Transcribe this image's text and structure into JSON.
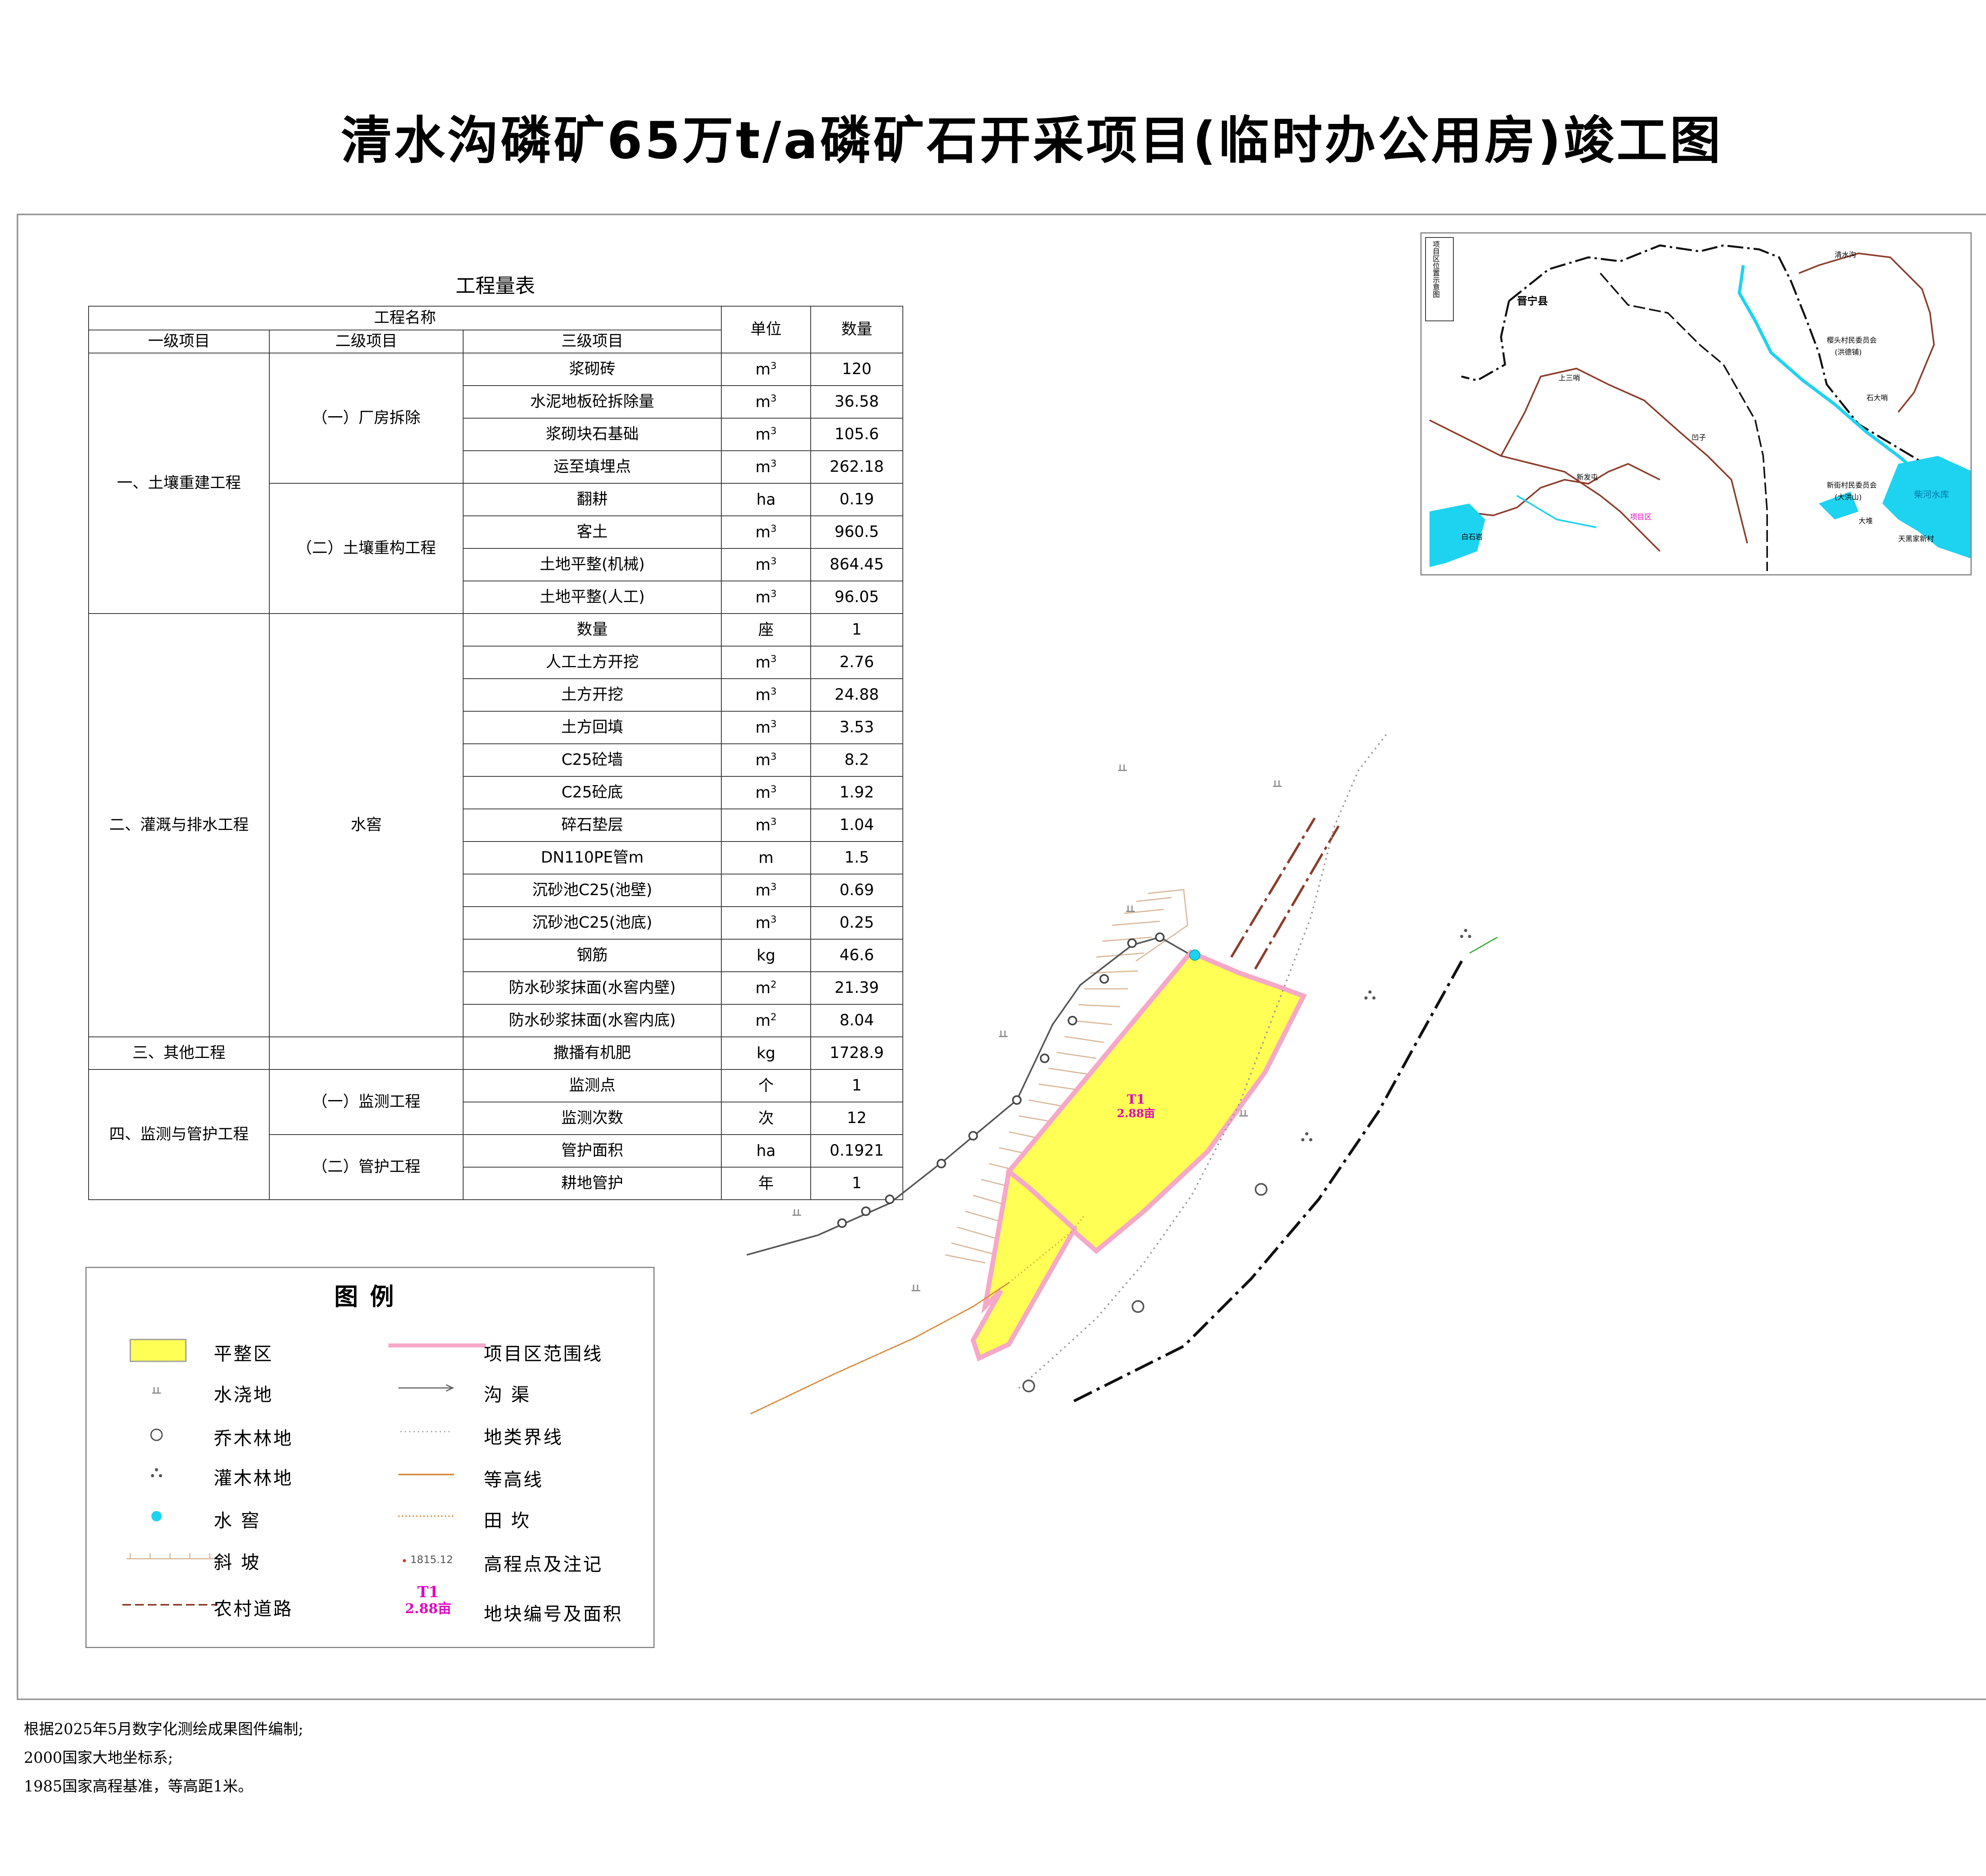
{
  "title": "清水沟磷矿65万t/a磷矿石开采项目(临时办公用房)竣工图",
  "table": {
    "caption": "工程量表",
    "header": {
      "project_name": "工程名称",
      "level1": "一级项目",
      "level2": "二级项目",
      "level3": "三级项目",
      "unit": "单位",
      "quantity": "数量"
    },
    "groups": [
      {
        "level1": "一、土壤重建工程",
        "subgroups": [
          {
            "level2": "（一）厂房拆除",
            "rows": [
              {
                "item": "浆砌砖",
                "unit": "m",
                "sup": "3",
                "qty": "120"
              },
              {
                "item": "水泥地板砼拆除量",
                "unit": "m",
                "sup": "3",
                "qty": "36.58"
              },
              {
                "item": "浆砌块石基础",
                "unit": "m",
                "sup": "3",
                "qty": "105.6"
              },
              {
                "item": "运至填埋点",
                "unit": "m",
                "sup": "3",
                "qty": "262.18"
              }
            ]
          },
          {
            "level2": "（二）土壤重构工程",
            "rows": [
              {
                "item": "翻耕",
                "unit": "ha",
                "sup": "",
                "qty": "0.19"
              },
              {
                "item": "客土",
                "unit": "m",
                "sup": "3",
                "qty": "960.5"
              },
              {
                "item": "土地平整(机械)",
                "unit": "m",
                "sup": "3",
                "qty": "864.45"
              },
              {
                "item": "土地平整(人工)",
                "unit": "m",
                "sup": "3",
                "qty": "96.05"
              }
            ]
          }
        ]
      },
      {
        "level1": "二、灌溉与排水工程",
        "subgroups": [
          {
            "level2": "水窖",
            "rows": [
              {
                "item": "数量",
                "unit": "座",
                "sup": "",
                "qty": "1"
              },
              {
                "item": "人工土方开挖",
                "unit": "m",
                "sup": "3",
                "qty": "2.76"
              },
              {
                "item": "土方开挖",
                "unit": "m",
                "sup": "3",
                "qty": "24.88"
              },
              {
                "item": "土方回填",
                "unit": "m",
                "sup": "3",
                "qty": "3.53"
              },
              {
                "item": "C25砼墙",
                "unit": "m",
                "sup": "3",
                "qty": "8.2"
              },
              {
                "item": "C25砼底",
                "unit": "m",
                "sup": "3",
                "qty": "1.92"
              },
              {
                "item": "碎石垫层",
                "unit": "m",
                "sup": "3",
                "qty": "1.04"
              },
              {
                "item": "DN110PE管m",
                "unit": "m",
                "sup": "",
                "qty": "1.5"
              },
              {
                "item": "沉砂池C25(池壁)",
                "unit": "m",
                "sup": "3",
                "qty": "0.69"
              },
              {
                "item": "沉砂池C25(池底)",
                "unit": "m",
                "sup": "3",
                "qty": "0.25"
              },
              {
                "item": "钢筋",
                "unit": "kg",
                "sup": "",
                "qty": "46.6"
              },
              {
                "item": "防水砂浆抹面(水窖内壁)",
                "unit": "m",
                "sup": "2",
                "qty": "21.39"
              },
              {
                "item": "防水砂浆抹面(水窖内底)",
                "unit": "m",
                "sup": "2",
                "qty": "8.04"
              }
            ]
          }
        ]
      },
      {
        "level1": "三、其他工程",
        "subgroups": [
          {
            "level2": "",
            "rows": [
              {
                "item": "撒播有机肥",
                "unit": "kg",
                "sup": "",
                "qty": "1728.9"
              }
            ]
          }
        ]
      },
      {
        "level1": "四、监测与管护工程",
        "subgroups": [
          {
            "level2": "（一）监测工程",
            "rows": [
              {
                "item": "监测点",
                "unit": "个",
                "sup": "",
                "qty": "1"
              },
              {
                "item": "监测次数",
                "unit": "次",
                "sup": "",
                "qty": "12"
              }
            ]
          },
          {
            "level2": "（二）管护工程",
            "rows": [
              {
                "item": "管护面积",
                "unit": "ha",
                "sup": "",
                "qty": "0.1921"
              },
              {
                "item": "耕地管护",
                "unit": "年",
                "sup": "",
                "qty": "1"
              }
            ]
          }
        ]
      }
    ]
  },
  "legend": {
    "title": "图例",
    "items": {
      "leveling_area": "平整区",
      "irrigated_land": "水浇地",
      "arbor_forest": "乔木林地",
      "shrub_forest": "灌木林地",
      "water_cellar": "水  窖",
      "slope": "斜  坡",
      "rural_road": "农村道路",
      "project_boundary": "项目区范围线",
      "ditch": "沟  渠",
      "landclass_boundary": "地类界线",
      "contour": "等高线",
      "field_ridge": "田  坎",
      "elevation_point": "高程点及注记",
      "elevation_sample": "1815.12",
      "parcel_note": "地块编号及面积",
      "parcel_id_sample": "T1",
      "parcel_area_sample": "2.88亩"
    }
  },
  "map": {
    "parcel_id": "T1",
    "parcel_area": "2.88亩"
  },
  "inset": {
    "title": "项目区位置示意图",
    "labels": {
      "county": "晋宁县",
      "place1": "清水沟",
      "place2": "樱头村民委员会",
      "place3": "(洪德铺)",
      "place4": "上三哨",
      "place5": "白石岩",
      "place6": "项目区",
      "place7": "新街村民委员会",
      "place8": "(大洪山)",
      "place9": "柴河水库",
      "place10": "天黑家新村",
      "place11": "石大哨",
      "place12": "凹子",
      "place13": "新发屯",
      "place14": "大堆"
    }
  },
  "notes": [
    "根据2025年5月数字化测绘成果图件编制;",
    "2000国家大地坐标系;",
    "1985国家高程基准，等高距1米。"
  ],
  "colors": {
    "leveling_fill": "#ffff55",
    "boundary": "#f6a8c8",
    "parcel_label": "#e000c0",
    "water": "#1ed3f0",
    "road": "#8c3c2a",
    "contour": "#d98a3a",
    "slope_hatch": "#d9b89a"
  }
}
